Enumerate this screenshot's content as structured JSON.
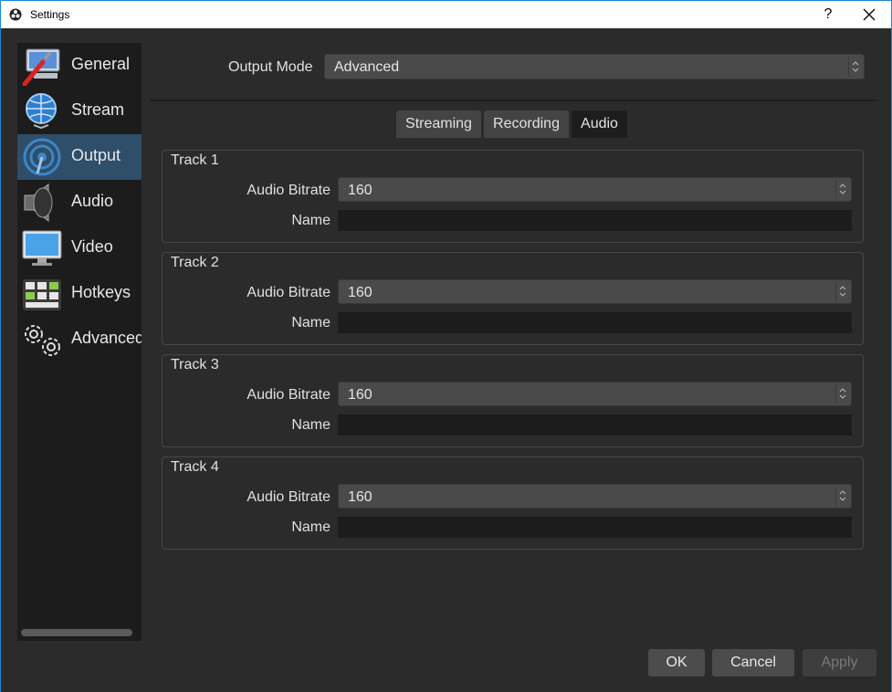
{
  "window": {
    "title": "Settings",
    "help": "?",
    "close": "✕"
  },
  "sidebar": {
    "items": [
      {
        "label": "General",
        "icon": "general-icon"
      },
      {
        "label": "Stream",
        "icon": "stream-globe-icon"
      },
      {
        "label": "Output",
        "icon": "output-broadcast-icon",
        "selected": true
      },
      {
        "label": "Audio",
        "icon": "speaker-icon"
      },
      {
        "label": "Video",
        "icon": "monitor-icon"
      },
      {
        "label": "Hotkeys",
        "icon": "keyboard-icon"
      },
      {
        "label": "Advanced",
        "icon": "gears-icon"
      }
    ]
  },
  "output_mode": {
    "label": "Output Mode",
    "value": "Advanced"
  },
  "tabs": [
    {
      "label": "Streaming"
    },
    {
      "label": "Recording"
    },
    {
      "label": "Audio",
      "active": true
    }
  ],
  "tracks": [
    {
      "title": "Track 1",
      "bitrate_label": "Audio Bitrate",
      "bitrate": "160",
      "name_label": "Name",
      "name": ""
    },
    {
      "title": "Track 2",
      "bitrate_label": "Audio Bitrate",
      "bitrate": "160",
      "name_label": "Name",
      "name": ""
    },
    {
      "title": "Track 3",
      "bitrate_label": "Audio Bitrate",
      "bitrate": "160",
      "name_label": "Name",
      "name": ""
    },
    {
      "title": "Track 4",
      "bitrate_label": "Audio Bitrate",
      "bitrate": "160",
      "name_label": "Name",
      "name": ""
    }
  ],
  "buttons": {
    "ok": "OK",
    "cancel": "Cancel",
    "apply": "Apply"
  },
  "colors": {
    "accent": "#1b86d6",
    "selected_nav": "#2e4e6a",
    "background": "#2b2b2b"
  }
}
